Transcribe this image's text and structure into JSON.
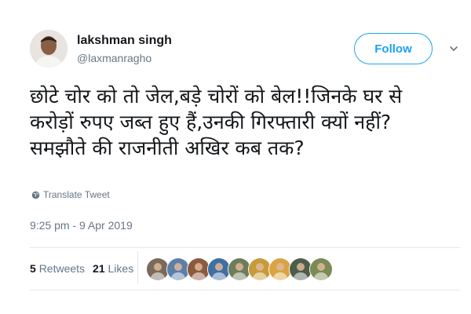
{
  "user": {
    "display_name": "lakshman singh",
    "handle": "@laxmanragho",
    "avatar_icon": "profile-photo"
  },
  "follow_button": {
    "label": "Follow",
    "color": "#1da1f2"
  },
  "menu": {
    "icon": "chevron-down-icon"
  },
  "tweet": {
    "lines": [
      "छोटे चोर को तो जेल,बड़े चोरों को बेल!!जिनके घर से",
      "करोड़ों रुपए जब्त हुए हैं,उनकी गिरफ्तारी क्यों नहीं?",
      "समझौते की राजनीती अखिर कब तक?"
    ]
  },
  "translate": {
    "label": "Translate Tweet",
    "icon": "globe-icon"
  },
  "timestamp": "9:25 pm - 9 Apr 2019",
  "stats": {
    "retweets_count": "5",
    "retweets_label": "Retweets",
    "likes_count": "21",
    "likes_label": "Likes"
  },
  "likers": [
    {
      "color": "#7a6a5a"
    },
    {
      "color": "#5b7fa8"
    },
    {
      "color": "#8c5a3c"
    },
    {
      "color": "#3f6fa3"
    },
    {
      "color": "#6f7c5a"
    },
    {
      "color": "#c79a3a"
    },
    {
      "color": "#d9a441"
    },
    {
      "color": "#4d5d4a"
    },
    {
      "color": "#7c8a55"
    }
  ]
}
